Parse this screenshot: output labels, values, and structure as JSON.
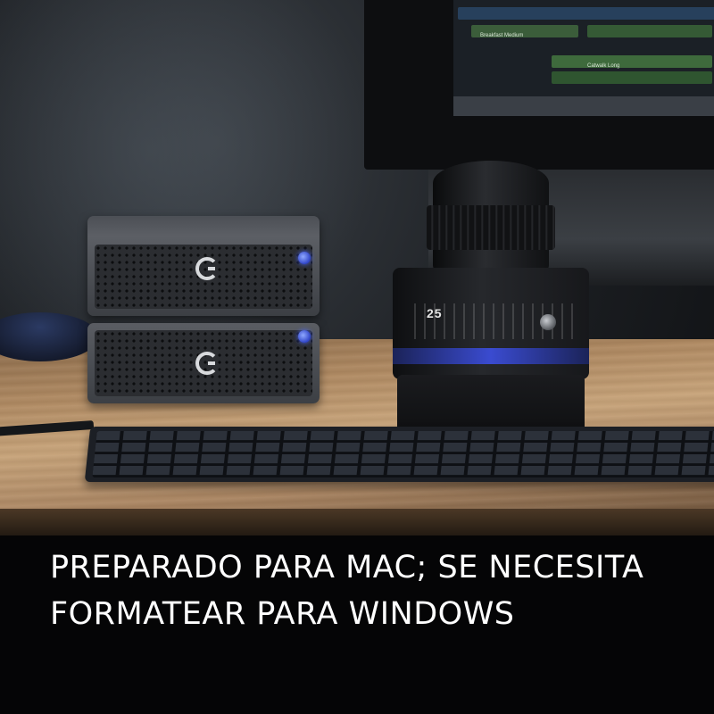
{
  "caption": {
    "line1": "PREPARADO PARA MAC; SE NECESITA",
    "line2": "FORMATEAR PARA WINDOWS"
  },
  "scene": {
    "drive_logo_letter": "G",
    "lens_scale_text": "25",
    "monitor_clip_labels": [
      "Breakfast Medium",
      "Catwalk Long"
    ],
    "colors": {
      "caption_text": "#ffffff",
      "led_blue": "#3045c8",
      "lens_accent_blue": "#3a4bd0",
      "desk_wood": "#c8a47a"
    }
  }
}
